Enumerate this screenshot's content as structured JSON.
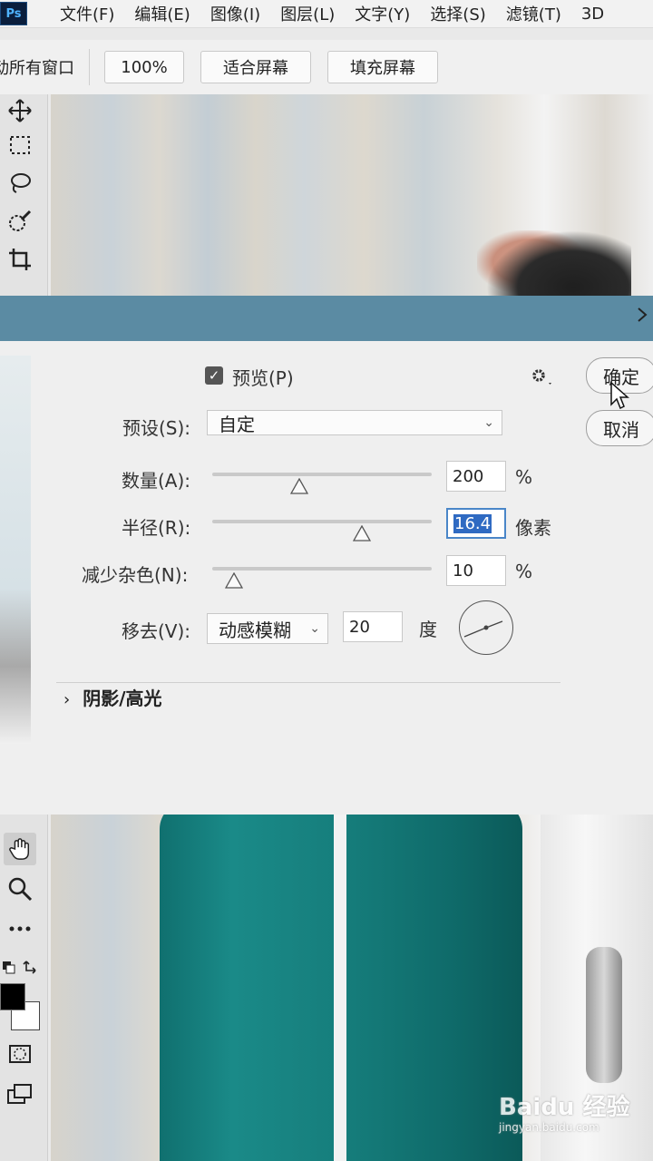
{
  "app": {
    "logo": "Ps"
  },
  "menu": [
    "文件(F)",
    "编辑(E)",
    "图像(I)",
    "图层(L)",
    "文字(Y)",
    "选择(S)",
    "滤镜(T)",
    "3D"
  ],
  "options_bar": {
    "label_partial": "动所有窗口",
    "zoom_value": "100%",
    "fit_screen": "适合屏幕",
    "fill_screen": "填充屏幕"
  },
  "dialog": {
    "preview_label": "预览(P)",
    "preview_checked": true,
    "ok_label": "确定",
    "cancel_label": "取消",
    "preset_label": "预设(S):",
    "preset_value": "自定",
    "amount_label": "数量(A):",
    "amount_value": "200",
    "amount_unit": "%",
    "radius_label": "半径(R):",
    "radius_value": "16.4",
    "radius_unit": "像素",
    "noise_label": "减少杂色(N):",
    "noise_value": "10",
    "noise_unit": "%",
    "remove_label": "移去(V):",
    "remove_value": "动感模糊",
    "angle_value": "20",
    "angle_unit": "度",
    "section_shadow": "阴影/高光"
  },
  "watermark": {
    "brand": "Baidu 经验",
    "url": "jingyan.baidu.com"
  },
  "icons": [
    "move-icon",
    "marquee-icon",
    "lasso-icon",
    "quick-select-icon",
    "crop-icon",
    "hand-icon",
    "zoom-icon",
    "more-tools-icon",
    "swap-colors-icon",
    "quick-mask-icon",
    "screen-mode-icon",
    "gear-icon",
    "close-icon",
    "chevron-down-icon",
    "chevron-right-icon"
  ],
  "colors": {
    "dialog_title_bar": "#5b8ba3",
    "selection": "#2f6ac2",
    "foreground": "#000000",
    "background": "#ffffff"
  }
}
